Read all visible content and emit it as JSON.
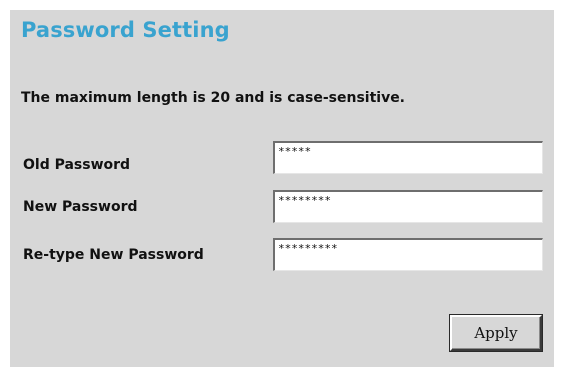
{
  "title": "Password Setting",
  "note": "The maximum length is 20 and is case-sensitive.",
  "fields": [
    {
      "label": "Old Password",
      "value": "*****"
    },
    {
      "label": "New Password",
      "value": "********"
    },
    {
      "label": "Re-type New Password",
      "value": "*********"
    }
  ],
  "apply_label": "Apply",
  "colors": {
    "title": "#39a3cf",
    "panel_background": "#d7d7d7"
  }
}
